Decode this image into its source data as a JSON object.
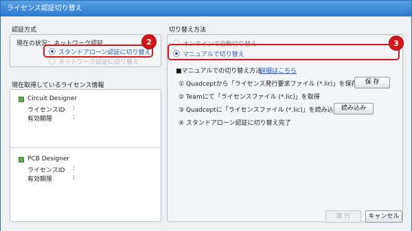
{
  "window": {
    "title": "ライセンス認証切り替え"
  },
  "auth_method": {
    "group_label": "認証方式",
    "current_status": "現在の状況：ネットワーク認証",
    "options": [
      {
        "label": "スタンドアローン認証に切り替え",
        "checked": true,
        "enabled": true
      },
      {
        "label": "ネットワーク認証に切り替え",
        "checked": false,
        "enabled": false
      }
    ],
    "callout": "2"
  },
  "license_info": {
    "group_label": "現在取得しているライセンス情報",
    "products": [
      {
        "name": "Circuit Designer",
        "id_label": "ライセンスID",
        "id_value": ":",
        "expiry_label": "有効期限",
        "expiry_value": ":"
      },
      {
        "name": "PCB Designer",
        "id_label": "ライセンスID",
        "id_value": ":",
        "expiry_label": "有効期限",
        "expiry_value": ":"
      }
    ]
  },
  "switch_method": {
    "group_label": "切り替え方法",
    "options": [
      {
        "label": "オンラインで自動切り替え",
        "checked": false,
        "enabled": false
      },
      {
        "label": "マニュアルで切り替え",
        "checked": true,
        "enabled": true
      }
    ],
    "callout": "3",
    "manual_heading": "■マニュアルでの切り替え方法",
    "details_link": "詳細はこちら",
    "steps": [
      {
        "text": "① Quadceptから「ライセンス発行要求ファイル (*.lir)」を保存",
        "button": "保 存"
      },
      {
        "text": "② Teamにて「ライセンスファイル (*.lic)」を取得"
      },
      {
        "text": "③ Quadceptに「ライセンスファイル (*.lic)」を読み込み",
        "button": "読み込み"
      },
      {
        "text": "④ スタンドアローン認証に切り替え完了"
      }
    ]
  },
  "footer": {
    "execute_label": "実 行",
    "cancel_label": "キャンセル"
  },
  "colors": {
    "accent": "#d4161a",
    "title_bar": "#2a78cf",
    "link": "#1a53c8"
  },
  "icons": {
    "product_active": "green-square-icon",
    "product_inactive": "gray-square-icon"
  }
}
